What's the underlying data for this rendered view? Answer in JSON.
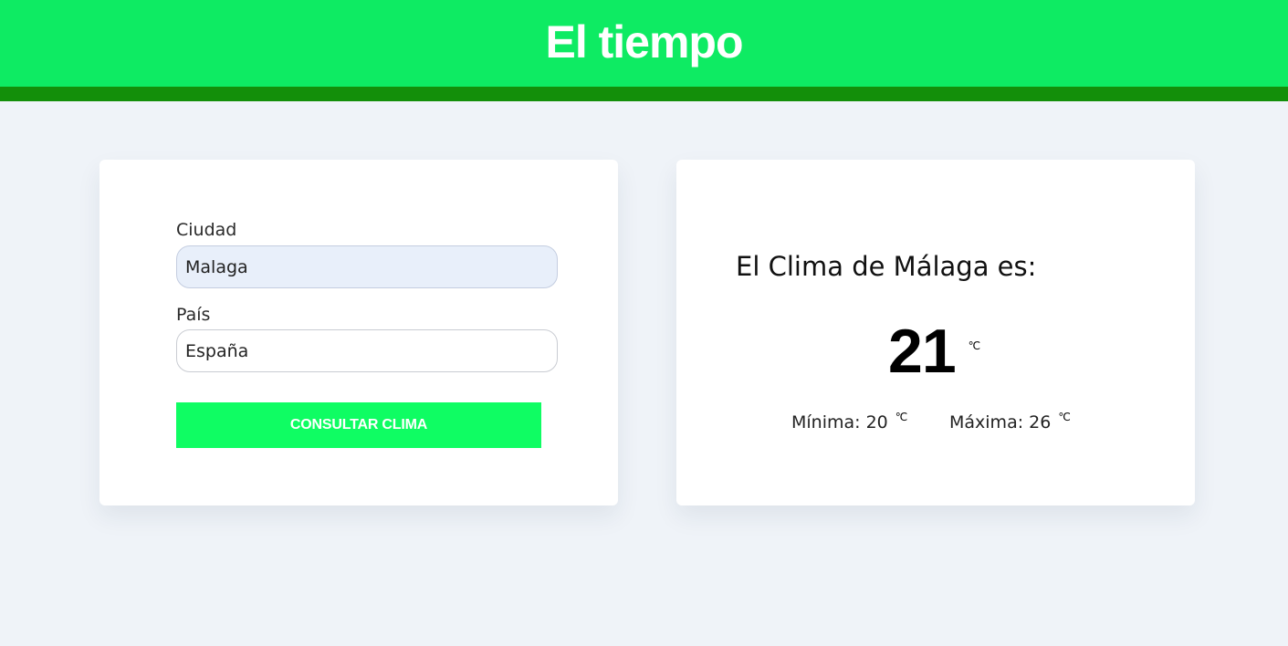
{
  "header": {
    "title": "El tiempo"
  },
  "form": {
    "city_label": "Ciudad",
    "city_value": "Malaga",
    "country_label": "País",
    "country_value": "España",
    "submit_label": "CONSULTAR CLIMA"
  },
  "result": {
    "heading": "El Clima de Málaga es:",
    "temperature": "21",
    "unit": "℃",
    "min_label": "Mínima: 20",
    "min_unit": "℃",
    "max_label": "Máxima: 26",
    "max_unit": "℃"
  },
  "colors": {
    "header_bg": "#0eeb63",
    "header_strip": "#138f0a",
    "button_bg": "#0ffd63",
    "page_bg": "#eff3f8"
  }
}
